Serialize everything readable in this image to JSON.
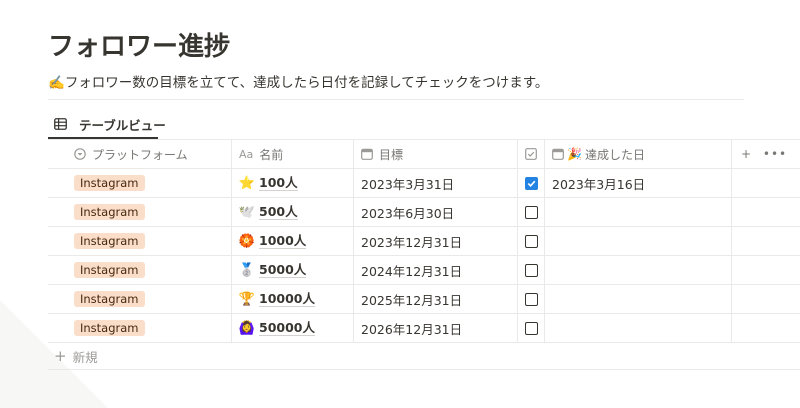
{
  "page": {
    "title": "フォロワー進捗",
    "description_icon": "✍️",
    "description": "フォロワー数の目標を立てて、達成したら日付を記録してチェックをつけます。"
  },
  "view": {
    "tab_label": "テーブルビュー",
    "tab_icon": "table-icon"
  },
  "columns": {
    "platform": {
      "label": "プラットフォーム",
      "icon": "select-icon"
    },
    "name": {
      "label": "名前",
      "icon": "text-aa-icon",
      "icon_text": "Aa"
    },
    "target": {
      "label": "目標",
      "icon": "calendar-icon"
    },
    "check": {
      "label": "",
      "icon": "checkbox-icon"
    },
    "achieved": {
      "label": "達成した日",
      "icon": "calendar-icon",
      "emoji": "🎉"
    }
  },
  "rows": [
    {
      "platform": "Instagram",
      "emoji": "⭐",
      "name": "100人",
      "target": "2023年3月31日",
      "checked": true,
      "achieved": "2023年3月16日"
    },
    {
      "platform": "Instagram",
      "emoji": "🕊️",
      "name": "500人",
      "target": "2023年6月30日",
      "checked": false,
      "achieved": ""
    },
    {
      "platform": "Instagram",
      "emoji": "🏵️",
      "name": "1000人",
      "target": "2023年12月31日",
      "checked": false,
      "achieved": ""
    },
    {
      "platform": "Instagram",
      "emoji": "🥈",
      "name": "5000人",
      "target": "2024年12月31日",
      "checked": false,
      "achieved": ""
    },
    {
      "platform": "Instagram",
      "emoji": "🏆",
      "name": "10000人",
      "target": "2025年12月31日",
      "checked": false,
      "achieved": ""
    },
    {
      "platform": "Instagram",
      "emoji": "🙆‍♀️",
      "name": "50000人",
      "target": "2026年12月31日",
      "checked": false,
      "achieved": ""
    }
  ],
  "table": {
    "new_label": "新規",
    "add_column_icon": "plus-icon",
    "more_icon": "more-icon"
  },
  "colors": {
    "tag_bg": "#fadec9",
    "tag_text": "#49290e",
    "checkbox_checked": "#2383e2"
  }
}
